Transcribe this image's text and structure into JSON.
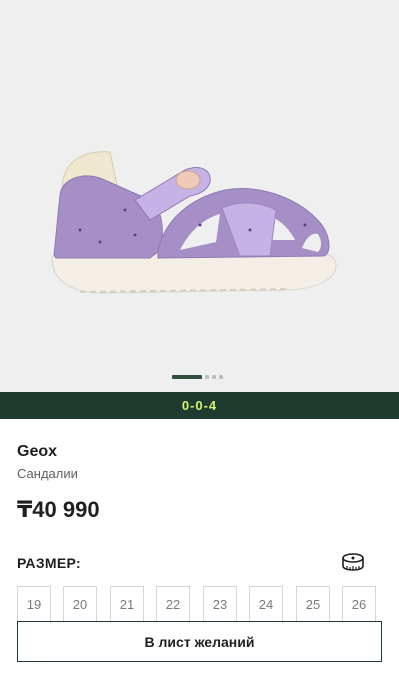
{
  "product": {
    "image": "purple-baby-sandal-photo",
    "brand": "Geox",
    "category": "Сандалии",
    "price": "₸40 990"
  },
  "gallery": {
    "total_slides": 4,
    "active_slide": 1
  },
  "promo": {
    "text": "0-0-4",
    "background": "#1e3b2f",
    "text_color": "#d3f36a"
  },
  "size_section": {
    "title": "РАЗМЕР:",
    "guide_icon": "measuring-tape-icon",
    "sizes": [
      "19",
      "20",
      "21",
      "22",
      "23",
      "24",
      "25",
      "26"
    ]
  },
  "actions": {
    "wishlist_label": "В лист желаний"
  }
}
